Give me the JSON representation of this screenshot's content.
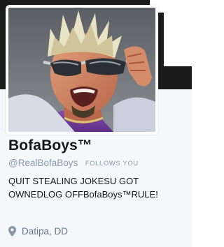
{
  "profile": {
    "display_name": "BofaBoys™",
    "handle": "@RealBofaBoys",
    "follows_you_badge": "FOLLOWS YOU",
    "bio": "QUIT STEALING JOKESU GOT OWNEDLOG OFFBofaBoys™RULE!",
    "location": "Datipa, DD",
    "icons": {
      "location": "location-pin-icon"
    }
  },
  "colors": {
    "name": "#14171a",
    "muted": "#8899a6",
    "location": "#657786",
    "profile_background": "#f5f8fa",
    "banner": "#1c1c1c"
  }
}
